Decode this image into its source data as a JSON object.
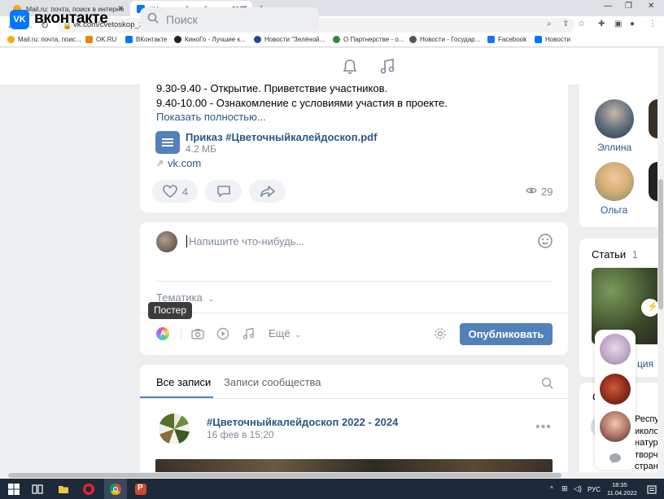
{
  "browser": {
    "tabs": [
      {
        "title": "Mail.ru: почта, поиск в интерне",
        "active": false
      },
      {
        "title": "#Цветочныйкалейдоскоп 2022",
        "active": true
      }
    ],
    "url": "vk.com/cvetoskop_2022",
    "bookmarks": [
      {
        "label": "Mail.ru: почта, поис...",
        "color": "#f6a81b"
      },
      {
        "label": "OK.RU",
        "color": "#ee8208"
      },
      {
        "label": "ВКонтакте",
        "color": "#0077ff"
      },
      {
        "label": "КиноГо - Лучшие к...",
        "color": "#222222"
      },
      {
        "label": "Новости \"Зелёной...",
        "color": "#1e4a9a"
      },
      {
        "label": "О Партнерстве - о...",
        "color": "#2a8a3a"
      },
      {
        "label": "Новости - Государ...",
        "color": "#555555"
      },
      {
        "label": "Facebook",
        "color": "#1877f2"
      },
      {
        "label": "Новости",
        "color": "#0077ff"
      }
    ]
  },
  "header": {
    "logo_mark": "VK",
    "brand": "вконтакте",
    "search_placeholder": "Поиск"
  },
  "post": {
    "lines": [
      "9.30-9.40 - Открытие. Приветствие участников.",
      "9.40-10.00 - Ознакомление с условиями участия в проекте."
    ],
    "show_more": "Показать полностью...",
    "doc_name": "Приказ #Цветочныйкалейдоскоп.pdf",
    "doc_size": "4.2 МБ",
    "link": "vk.com",
    "likes": "4",
    "views": "29"
  },
  "composer": {
    "placeholder": "Напишите что-нибудь...",
    "topic": "Тематика",
    "tooltip": "Постер",
    "more": "Ещё",
    "publish": "Опубликовать"
  },
  "feed_tabs": {
    "all": "Все записи",
    "community": "Записи сообщества"
  },
  "post2": {
    "title": "#Цветочныйкалейдоскоп 2022 - 2024",
    "date": "16 фев в 15:20"
  },
  "sidebar": {
    "friends": [
      {
        "name": "Эллина"
      },
      {
        "name": "Ольга"
      }
    ],
    "articles_label": "Статьи",
    "articles_count": "1",
    "partial": [
      "Респу",
      "иколо",
      "натур",
      "творч",
      "странч"
    ],
    "partial2": [
      "ция",
      "С"
    ]
  },
  "taskbar": {
    "lang": "РУС",
    "time": "18:35",
    "date": "11.04.2022"
  },
  "colors": {
    "vk_blue": "#0077ff",
    "button_blue": "#5181b8",
    "link_blue": "#2a5885"
  }
}
